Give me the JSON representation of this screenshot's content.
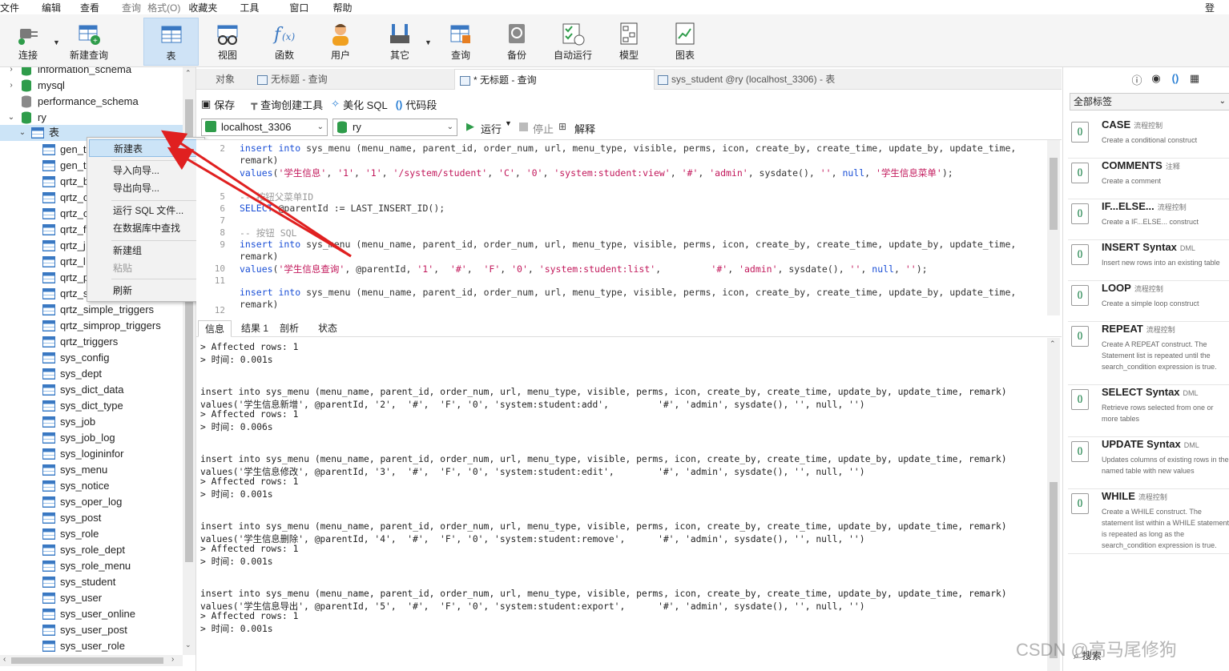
{
  "menubar": {
    "items": [
      "文件",
      "编辑",
      "查看",
      "查询",
      "格式(O)",
      "收藏夹",
      "工具",
      "窗口",
      "帮助"
    ],
    "right": "登"
  },
  "toolbar": {
    "buttons": [
      "连接",
      "新建查询",
      "表",
      "视图",
      "函数",
      "用户",
      "其它",
      "查询",
      "备份",
      "自动运行",
      "模型",
      "图表"
    ]
  },
  "sidebar": {
    "databases": [
      "information_schema",
      "mysql",
      "performance_schema",
      "ry"
    ],
    "tables_node": "表",
    "tables": [
      "gen_t",
      "gen_t",
      "qrtz_b",
      "qrtz_c",
      "qrtz_c",
      "qrtz_f",
      "qrtz_j",
      "qrtz_l",
      "qrtz_p",
      "qrtz_s",
      "qrtz_simple_triggers",
      "qrtz_simprop_triggers",
      "qrtz_triggers",
      "sys_config",
      "sys_dept",
      "sys_dict_data",
      "sys_dict_type",
      "sys_job",
      "sys_job_log",
      "sys_logininfor",
      "sys_menu",
      "sys_notice",
      "sys_oper_log",
      "sys_post",
      "sys_role",
      "sys_role_dept",
      "sys_role_menu",
      "sys_student",
      "sys_user",
      "sys_user_online",
      "sys_user_post",
      "sys_user_role"
    ]
  },
  "context_menu": {
    "items": [
      "新建表",
      "导入向导...",
      "导出向导...",
      "运行 SQL 文件...",
      "在数据库中查找",
      "新建组",
      "粘贴",
      "刷新"
    ]
  },
  "tabs": [
    "对象",
    "无标题 - 查询",
    "* 无标题 - 查询",
    "sys_student @ry (localhost_3306) - 表"
  ],
  "editor_toolbar": {
    "save": "保存",
    "builder": "查询创建工具",
    "beautify": "美化 SQL",
    "snippet": "代码段"
  },
  "connection": {
    "server": "localhost_3306",
    "database": "ry",
    "run": "运行",
    "stop": "停止",
    "explain": "解释"
  },
  "editor": {
    "line_numbers": [
      "2",
      "",
      "",
      "5",
      "6",
      "7",
      "8",
      "9",
      "",
      "10",
      "11",
      "",
      "12"
    ]
  },
  "result_tabs": [
    "信息",
    "结果 1",
    "剖析",
    "状态"
  ],
  "output": {
    "lines": [
      "> Affected rows: 1",
      "> 时间: 0.001s",
      "",
      "",
      "insert into sys_menu (menu_name, parent_id, order_num, url, menu_type, visible, perms, icon, create_by, create_time, update_by, update_time, remark)",
      "values('学生信息新增', @parentId, '2',  '#',  'F', '0', 'system:student:add',         '#', 'admin', sysdate(), '', null, '')",
      "> Affected rows: 1",
      "> 时间: 0.006s",
      "",
      "",
      "insert into sys_menu (menu_name, parent_id, order_num, url, menu_type, visible, perms, icon, create_by, create_time, update_by, update_time, remark)",
      "values('学生信息修改', @parentId, '3',  '#',  'F', '0', 'system:student:edit',        '#', 'admin', sysdate(), '', null, '')",
      "> Affected rows: 1",
      "> 时间: 0.001s",
      "",
      "",
      "insert into sys_menu (menu_name, parent_id, order_num, url, menu_type, visible, perms, icon, create_by, create_time, update_by, update_time, remark)",
      "values('学生信息删除', @parentId, '4',  '#',  'F', '0', 'system:student:remove',      '#', 'admin', sysdate(), '', null, '')",
      "> Affected rows: 1",
      "> 时间: 0.001s",
      "",
      "",
      "insert into sys_menu (menu_name, parent_id, order_num, url, menu_type, visible, perms, icon, create_by, create_time, update_by, update_time, remark)",
      "values('学生信息导出', @parentId, '5',  '#',  'F', '0', 'system:student:export',      '#', 'admin', sysdate(), '', null, '')",
      "> Affected rows: 1",
      "> 时间: 0.001s"
    ]
  },
  "right_pane": {
    "filter": "全部标签",
    "snippets": [
      {
        "title": "CASE",
        "tag": "流程控制",
        "desc": "Create a conditional construct"
      },
      {
        "title": "COMMENTS",
        "tag": "注释",
        "desc": "Create a comment"
      },
      {
        "title": "IF...ELSE...",
        "tag": "流程控制",
        "desc": "Create a IF...ELSE... construct"
      },
      {
        "title": "INSERT Syntax",
        "tag": "DML",
        "desc": "Insert new rows into an existing table"
      },
      {
        "title": "LOOP",
        "tag": "流程控制",
        "desc": "Create a simple loop construct"
      },
      {
        "title": "REPEAT",
        "tag": "流程控制",
        "desc": "Create A REPEAT construct. The Statement list is repeated until the search_condition expression is true."
      },
      {
        "title": "SELECT Syntax",
        "tag": "DML",
        "desc": "Retrieve rows selected from one or more tables"
      },
      {
        "title": "UPDATE Syntax",
        "tag": "DML",
        "desc": "Updates columns of existing rows in the named table with new values"
      },
      {
        "title": "WHILE",
        "tag": "流程控制",
        "desc": "Create a WHILE construct. The statement list within a WHILE statement is repeated as long as the search_condition expression is true."
      }
    ],
    "search": "搜索"
  },
  "watermark": "CSDN @高马尾修狗",
  "colors": {
    "keyword": "#1a4fd6",
    "string": "#c2185b",
    "active_tool": "#cfe3f6",
    "arrow": "#e02020"
  }
}
